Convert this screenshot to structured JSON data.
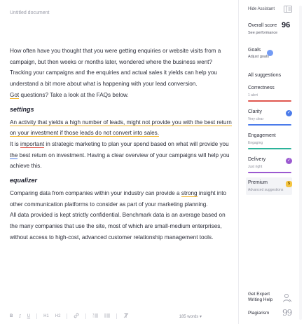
{
  "document": {
    "title": "Untitled document",
    "p1": "How often have you thought that you were getting enquiries or website visits from a campaign, but then weeks or months later, wondered where the business went?",
    "p2": "Tracking your campaigns and the enquiries and actual sales it yields can help you understand a bit more about what is happening with your lead conversion.",
    "p3_word": "Got",
    "p3_rest": " questions? Take a look at the FAQs below.",
    "h1": "settings",
    "p4": "An activity that yields a high number of leads, might not provide you with the best return on your investment if those leads do not convert into sales.",
    "p5_a": "It is ",
    "p5_word": "important",
    "p5_b": " in strategic marketing to plan your spend based on what will provide you ",
    "p5_word2": "the",
    "p5_c": " best return on investment. Having a clear overview of your campaigns will help you achieve this.",
    "h2": "equalizer",
    "p6_a": "Comparing data from companies within your industry can provide a ",
    "p6_word": "strong",
    "p6_b": " insight into other communication platforms to consider as part of your marketing planning.",
    "p7": "All data provided is kept strictly confidential. Benchmark data is an average based on the many companies that use the site, most of which are small-medium enterprises, without access to high-cost, advanced customer relationship management tools."
  },
  "toolbar": {
    "bold": "B",
    "italic": "I",
    "underline": "U",
    "h1": "H1",
    "h2": "H2",
    "link": "🔗",
    "ol": "☰",
    "ul": "☰",
    "clear": "T̶",
    "word_count": "185 words ▾"
  },
  "sidebar": {
    "hide_assistant": "Hide Assistant",
    "overall_score_label": "Overall score",
    "overall_score": "96",
    "see_performance": "See performance",
    "goals_label": "Goals",
    "goals_sub": "Adjust goals",
    "all_suggestions": "All suggestions",
    "categories": [
      {
        "label": "Correctness",
        "sub": "1 alert",
        "color": "#e0574f"
      },
      {
        "label": "Clarity",
        "sub": "Very clear",
        "color": "#4b7bea"
      },
      {
        "label": "Engagement",
        "sub": "Engaging",
        "color": "#2bb39a"
      },
      {
        "label": "Delivery",
        "sub": "Just right",
        "color": "#9b59d0"
      },
      {
        "label": "Premium",
        "sub": "Advanced suggestions",
        "badge": "5"
      }
    ],
    "expert_help": "Get Expert Writing Help",
    "plagiarism": "Plagiarism",
    "plag_icon": "99"
  }
}
